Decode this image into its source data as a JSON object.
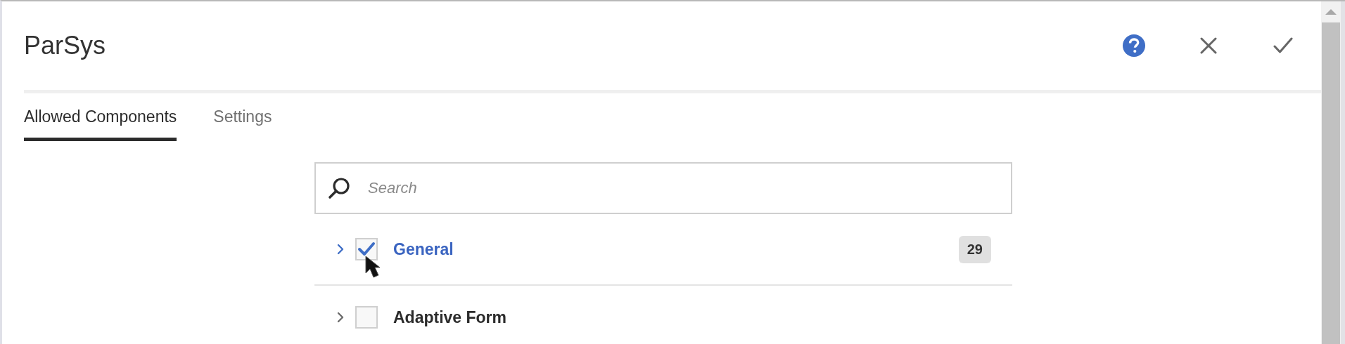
{
  "dialog": {
    "title": "ParSys"
  },
  "tabs": [
    {
      "label": "Allowed Components",
      "selected": true
    },
    {
      "label": "Settings",
      "selected": false
    }
  ],
  "search": {
    "placeholder": "Search"
  },
  "groups": [
    {
      "name": "General",
      "checked": true,
      "count": "29"
    },
    {
      "name": "Adaptive Form",
      "checked": false
    }
  ]
}
